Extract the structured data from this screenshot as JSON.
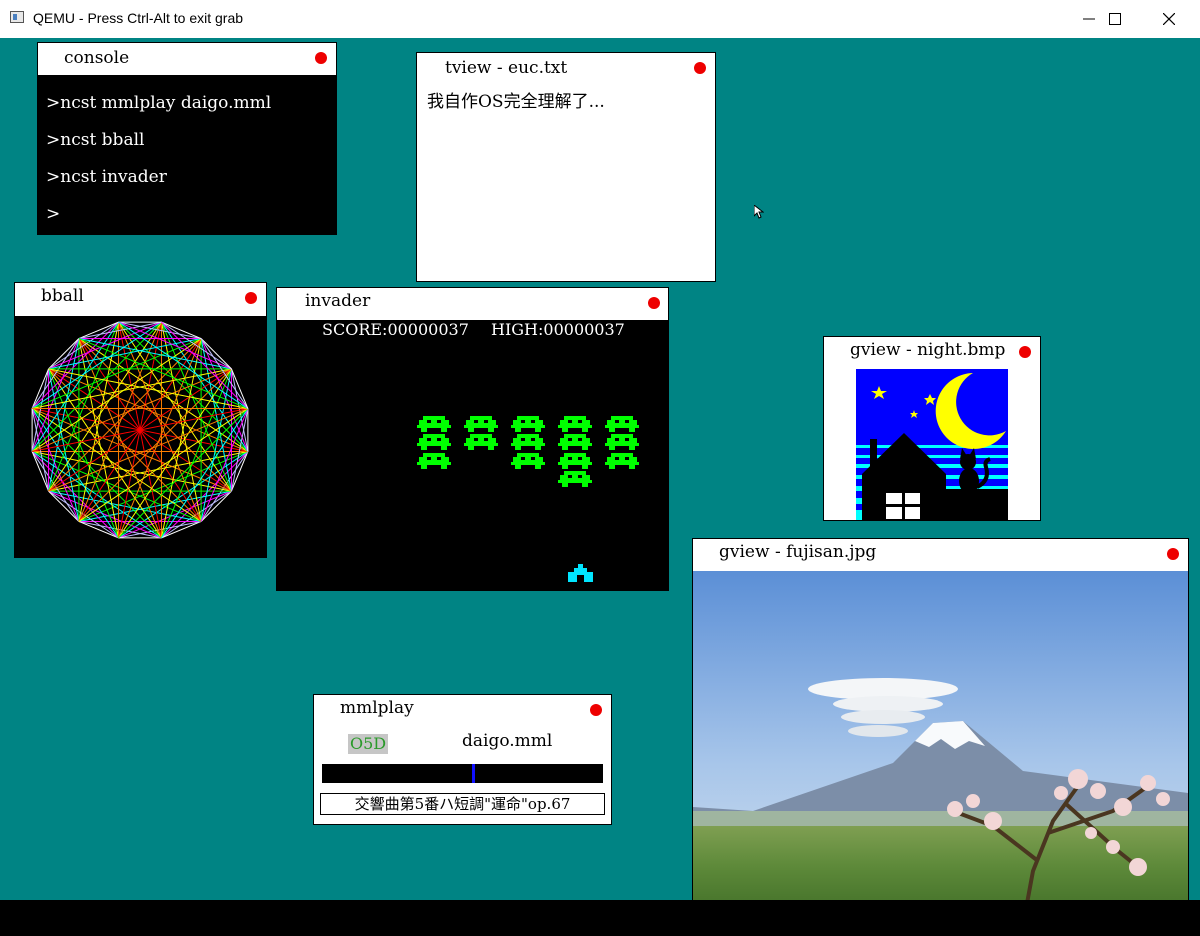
{
  "host": {
    "title": "QEMU - Press Ctrl-Alt to exit grab"
  },
  "colors": {
    "desktop": "#008484",
    "close_dot": "#ee0000",
    "alien": "#00ff00",
    "cannon": "#00e5ff",
    "progress_marker": "#1010ff"
  },
  "console": {
    "title": "console",
    "lines": [
      ">ncst mmlplay daigo.mml",
      ">ncst bball",
      ">ncst invader",
      ">"
    ]
  },
  "tview": {
    "title": "tview - euc.txt",
    "text": "我自作OS完全理解了..."
  },
  "bball": {
    "title": "bball"
  },
  "invader": {
    "title": "invader",
    "score": "SCORE:00000037",
    "high": "HIGH:00000037"
  },
  "gview_night": {
    "title": "gview - night.bmp"
  },
  "gview_fuji": {
    "title": "gview - fujisan.jpg"
  },
  "mmlplay": {
    "title": "mmlplay",
    "octave": "O5D",
    "file": "daigo.mml",
    "progress": 0.54,
    "song_title": "交響曲第5番ハ短調\"運命\"op.67"
  }
}
